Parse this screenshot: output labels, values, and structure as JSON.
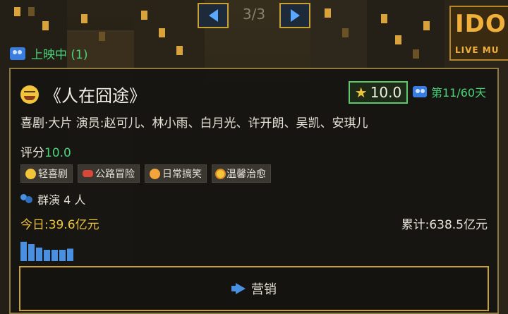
{
  "pager": {
    "indicator": "3/3"
  },
  "status": {
    "showing_label": "上映中 (1)"
  },
  "movie": {
    "title": "《人在囧途》",
    "score": "10.0",
    "day_label": "第11/60天",
    "info": "喜剧·大片  演员:赵可儿、林小雨、白月光、许开朗、吴凯、安琪儿",
    "rating_label": "评分",
    "rating_value": "10.0",
    "tags": [
      "轻喜剧",
      "公路冒险",
      "日常搞笑",
      "温馨治愈"
    ],
    "extras": "群演 4 人",
    "today": "今日:39.6亿元",
    "total": "累计:638.5亿元",
    "trend": [
      0.85,
      0.75,
      0.6,
      0.5,
      0.5,
      0.5,
      0.55
    ],
    "marketing_label": "营销"
  },
  "colors": {
    "accent": "#c9a035",
    "positive": "#48d37a",
    "money": "#f0c43a"
  },
  "icons": {
    "prev": "left-arrow-icon",
    "next": "right-arrow-icon",
    "camera": "movie-camera-icon",
    "star": "star-icon",
    "extras": "people-icon",
    "marketing": "megaphone-icon"
  }
}
